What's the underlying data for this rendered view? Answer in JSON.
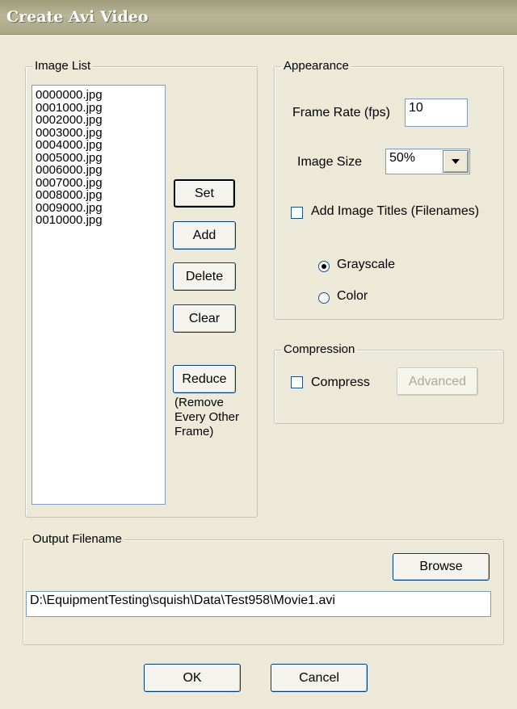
{
  "window": {
    "title": "Create Avi Video"
  },
  "image_list": {
    "legend": "Image List",
    "items": [
      "0000000.jpg",
      "0001000.jpg",
      "0002000.jpg",
      "0003000.jpg",
      "0004000.jpg",
      "0005000.jpg",
      "0006000.jpg",
      "0007000.jpg",
      "0008000.jpg",
      "0009000.jpg",
      "0010000.jpg"
    ],
    "buttons": {
      "set": "Set",
      "add": "Add",
      "delete": "Delete",
      "clear": "Clear",
      "reduce": "Reduce"
    },
    "reduce_note": [
      "(Remove",
      "Every Other",
      "Frame)"
    ]
  },
  "appearance": {
    "legend": "Appearance",
    "frame_rate_label": "Frame Rate (fps)",
    "frame_rate_value": "10",
    "image_size_label": "Image Size",
    "image_size_value": "50%",
    "add_titles_label": "Add Image Titles (Filenames)",
    "add_titles_checked": false,
    "grayscale_label": "Grayscale",
    "color_label": "Color",
    "selected_mode": "Grayscale"
  },
  "compression": {
    "legend": "Compression",
    "compress_label": "Compress",
    "compress_checked": false,
    "advanced_label": "Advanced"
  },
  "output": {
    "legend": "Output Filename",
    "browse_label": "Browse",
    "filename": "D:\\EquipmentTesting\\squish\\Data\\Test958\\Movie1.avi"
  },
  "footer": {
    "ok_label": "OK",
    "cancel_label": "Cancel"
  },
  "icons": {
    "dropdown": "chevron-down-icon"
  }
}
